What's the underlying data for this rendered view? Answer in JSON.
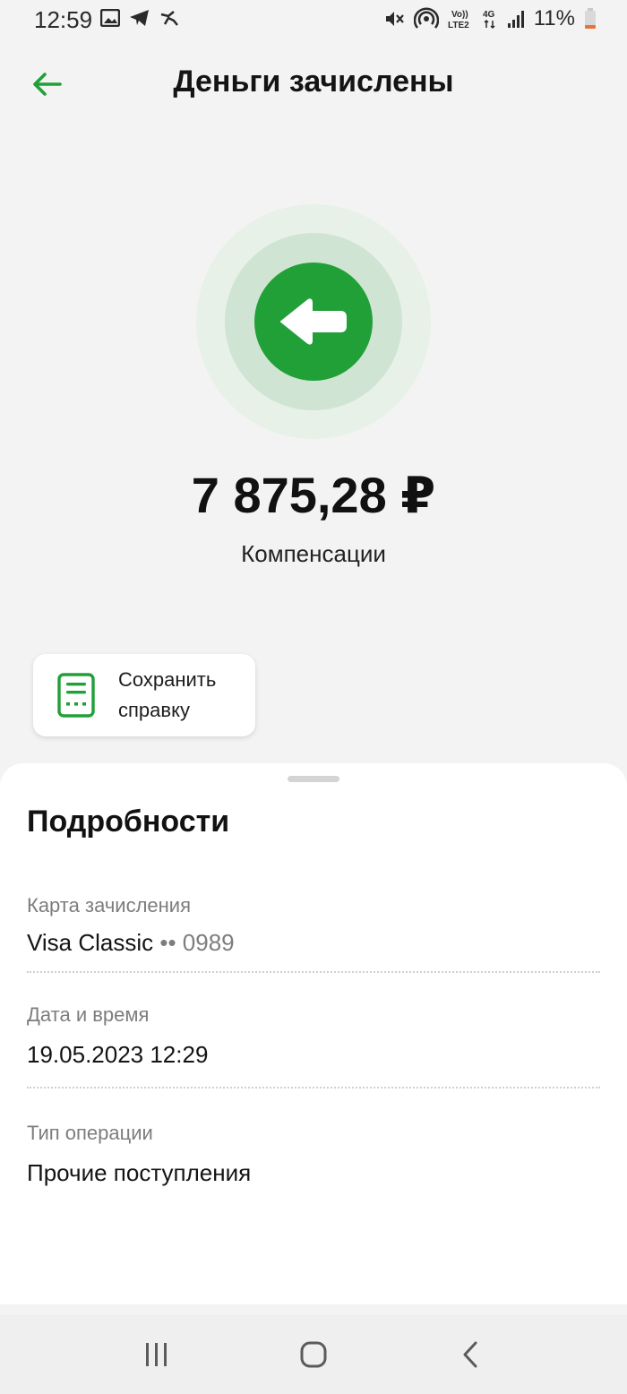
{
  "status_bar": {
    "time": "12:59",
    "battery_percent": "11%",
    "icons": [
      "image-icon",
      "telegram-icon",
      "app-icon",
      "mute-icon",
      "hotspot-icon",
      "volte-icon",
      "4g-icon",
      "signal-icon",
      "battery-icon"
    ]
  },
  "header": {
    "title": "Деньги зачислены",
    "back_icon": "arrow-left-icon"
  },
  "colors": {
    "accent": "#21a038",
    "background": "#f3f3f3"
  },
  "transaction": {
    "amount": "7 875,28 ₽",
    "category": "Компенсации",
    "status_icon": "incoming-arrow-icon"
  },
  "actions": {
    "save_receipt_label": "Сохранить справку"
  },
  "details": {
    "title": "Подробности",
    "card_label": "Карта зачисления",
    "card_name": "Visa Classic",
    "card_mask": "•• 0989",
    "datetime_label": "Дата и время",
    "datetime_value": "19.05.2023 12:29",
    "operation_label": "Тип операции",
    "operation_value": "Прочие поступления"
  },
  "nav": {
    "items": [
      "recents-icon",
      "home-icon",
      "back-icon"
    ]
  }
}
